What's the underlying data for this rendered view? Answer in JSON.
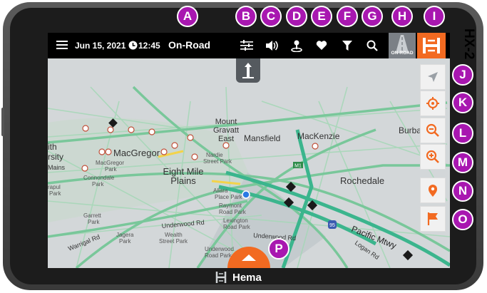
{
  "topbar": {
    "date": "Jun 15, 2021",
    "time": "12:45",
    "mode": "On-Road",
    "mode_toggle_label": "ON-ROAD"
  },
  "map": {
    "labels": [
      {
        "text": "Mount"
      },
      {
        "text": "Gravatt"
      },
      {
        "text": "East"
      },
      {
        "text": "Mansfield"
      },
      {
        "text": "MacKenzie"
      },
      {
        "text": "Burba"
      },
      {
        "text": "MacGregor"
      },
      {
        "text": "MacGregor"
      },
      {
        "text": "Park"
      },
      {
        "text": "Eight Mile"
      },
      {
        "text": "Plains"
      },
      {
        "text": "Nardie"
      },
      {
        "text": "Street Park"
      },
      {
        "text": "Connondale"
      },
      {
        "text": "Park"
      },
      {
        "text": "Rochedale"
      },
      {
        "text": "Garrett"
      },
      {
        "text": "Park"
      },
      {
        "text": "Jagera"
      },
      {
        "text": "Park"
      },
      {
        "text": "Wealth"
      },
      {
        "text": "Street Park"
      },
      {
        "text": "Underwood Rd"
      },
      {
        "text": "Underwood Rd"
      },
      {
        "text": "Pacific Mtwy"
      },
      {
        "text": "Logan Rd"
      },
      {
        "text": "Warrigal Rd"
      },
      {
        "text": "Allara"
      },
      {
        "text": "Place Park"
      },
      {
        "text": "Raymont"
      },
      {
        "text": "Road Park"
      },
      {
        "text": "Lexington"
      },
      {
        "text": "Road Park"
      },
      {
        "text": "Underwood"
      },
      {
        "text": "Road Park"
      },
      {
        "text": "ith"
      },
      {
        "text": "rsity"
      },
      {
        "text": "Mains"
      },
      {
        "text": "rapul"
      },
      {
        "text": "Park"
      }
    ],
    "shields": [
      "M1",
      "95"
    ]
  },
  "callouts": [
    "A",
    "B",
    "C",
    "D",
    "E",
    "F",
    "G",
    "H",
    "I",
    "J",
    "K",
    "L",
    "M",
    "N",
    "O",
    "P"
  ],
  "device": {
    "model": "HX-2",
    "brand": "Hema"
  },
  "colors": {
    "accent": "#f26a21",
    "callout": "#a817b0",
    "route": "#36b48a",
    "road": "#8dd0a8"
  }
}
